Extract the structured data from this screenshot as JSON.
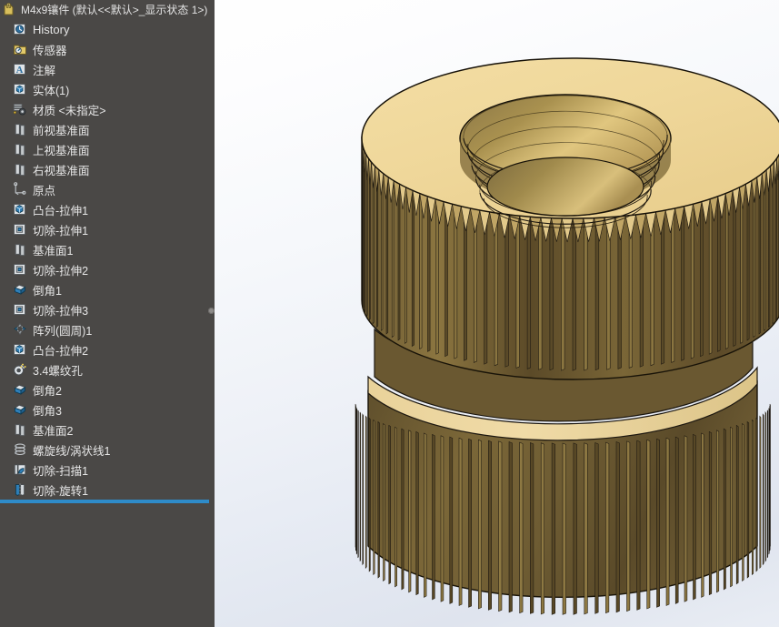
{
  "window": {
    "title": "M4x9镶件  (默认<<默认>_显示状态 1>)",
    "title_icon": "part-document-icon"
  },
  "feature_tree": {
    "panel_name": "FeatureManager design tree",
    "items": [
      {
        "label": "History",
        "icon": "history-icon",
        "indent": 0
      },
      {
        "label": "传感器",
        "icon": "sensors-icon",
        "indent": 0
      },
      {
        "label": "注解",
        "icon": "annotations-icon",
        "indent": 0
      },
      {
        "label": "实体(1)",
        "icon": "solid-bodies-icon",
        "indent": 0
      },
      {
        "label": "材质 <未指定>",
        "icon": "material-icon",
        "indent": 0
      },
      {
        "label": "前视基准面",
        "icon": "plane-icon",
        "indent": 0
      },
      {
        "label": "上视基准面",
        "icon": "plane-icon",
        "indent": 0
      },
      {
        "label": "右视基准面",
        "icon": "plane-icon",
        "indent": 0
      },
      {
        "label": "原点",
        "icon": "origin-icon",
        "indent": 0
      },
      {
        "label": "凸台-拉伸1",
        "icon": "boss-extrude-icon",
        "indent": 0
      },
      {
        "label": "切除-拉伸1",
        "icon": "cut-extrude-icon",
        "indent": 0
      },
      {
        "label": "基准面1",
        "icon": "plane-icon",
        "indent": 0
      },
      {
        "label": "切除-拉伸2",
        "icon": "cut-extrude-icon",
        "indent": 0
      },
      {
        "label": "倒角1",
        "icon": "chamfer-icon",
        "indent": 0
      },
      {
        "label": "切除-拉伸3",
        "icon": "cut-extrude-icon",
        "indent": 0
      },
      {
        "label": "阵列(圆周)1",
        "icon": "circular-pattern-icon",
        "indent": 0
      },
      {
        "label": "凸台-拉伸2",
        "icon": "boss-extrude-icon",
        "indent": 0
      },
      {
        "label": "3.4螺纹孔",
        "icon": "hole-wizard-icon",
        "indent": 0
      },
      {
        "label": "倒角2",
        "icon": "chamfer-icon",
        "indent": 0
      },
      {
        "label": "倒角3",
        "icon": "chamfer-icon",
        "indent": 0
      },
      {
        "label": "基准面2",
        "icon": "plane-icon",
        "indent": 0
      },
      {
        "label": "螺旋线/涡状线1",
        "icon": "helix-icon",
        "indent": 0
      },
      {
        "label": "切除-扫描1",
        "icon": "cut-sweep-icon",
        "indent": 0
      },
      {
        "label": "切除-旋转1",
        "icon": "cut-revolve-icon",
        "indent": 0
      }
    ],
    "rollback_bar": {
      "name": "rollback-bar",
      "visible": true
    }
  },
  "viewport": {
    "name": "graphics-area",
    "model_name": "M4x9镶件",
    "model_description": "brass knurled threaded insert, isometric shaded view",
    "background_top": "#ffffff",
    "background_bottom": "#e2e7f0"
  },
  "colors": {
    "panel_background": "#4a4846",
    "panel_text": "#e6e6e6",
    "rollback_accent": "#2e8bc9",
    "brass_light": "#f0d999",
    "brass_mid": "#c9a961",
    "brass_dark": "#6b5a36",
    "brass_shadow": "#4a3d22",
    "edge_line": "#1c1710"
  }
}
